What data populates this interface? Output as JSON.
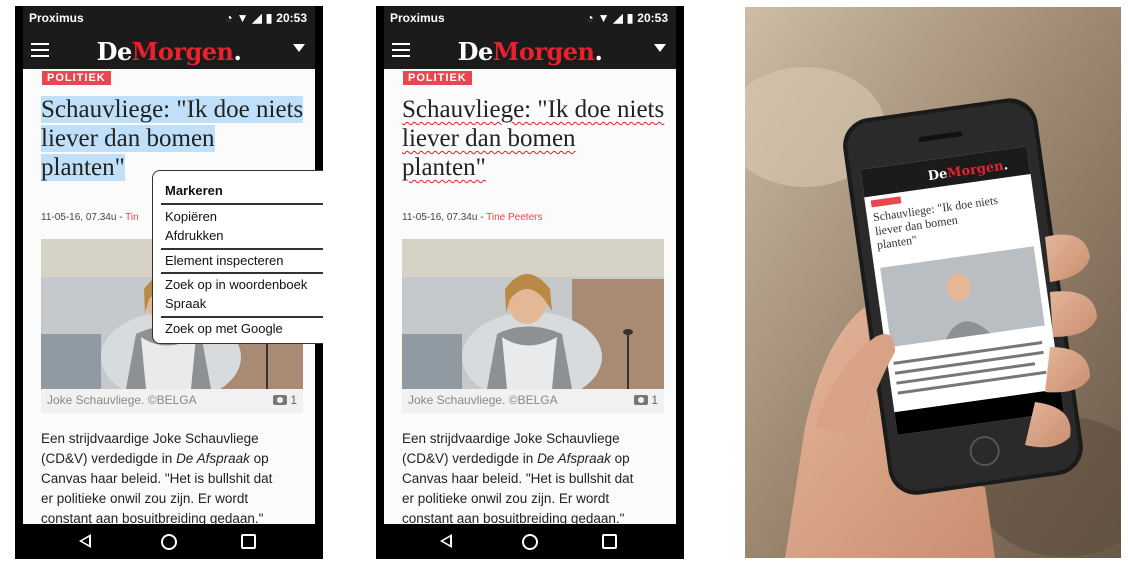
{
  "status": {
    "carrier": "Proximus",
    "time": "20:53"
  },
  "app": {
    "logo_part1": "De",
    "logo_part2": "Morgen",
    "logo_part3": "."
  },
  "article": {
    "category": "POLITIEK",
    "headline_lines": [
      "Schauvliege: \"Ik doe niets",
      "liever dan bomen",
      "planten\""
    ],
    "date": "11-05-16, 07.34u",
    "meta_sep": " - ",
    "author": "Tine Peeters",
    "author_truncated": "Tin",
    "photo_caption": "Joke Schauvliege. ©BELGA",
    "photo_count": "1",
    "body": [
      "Een strijdvaardige Joke Schauvliege",
      [
        "(CD&V) verdedigde in ",
        "De Afspraak",
        " op"
      ],
      "Canvas haar beleid. \"Het is bullshit dat",
      "er politieke onwil zou zijn. Er wordt",
      "constant aan bosuitbreiding gedaan.\""
    ]
  },
  "context_menu": {
    "items": [
      "Markeren",
      "Kopiëren",
      "Afdrukken",
      "Element inspecteren",
      "Zoek op in woordenboek",
      "Spraak",
      "Zoek op met Google"
    ]
  },
  "icons": {
    "menu": "hamburger-icon",
    "dropdown": "caret-down-icon",
    "camera": "camera-icon",
    "nav": [
      "back-icon",
      "home-icon",
      "recents-icon"
    ],
    "status": [
      "vibrate-icon",
      "wifi-icon",
      "signal-icon",
      "battery-icon"
    ]
  },
  "colors": {
    "accent": "#e8474f",
    "logo_red": "#e8222d",
    "bar": "#1b1b1b",
    "selection": "#bfe0f8",
    "spell": "#e02020"
  }
}
